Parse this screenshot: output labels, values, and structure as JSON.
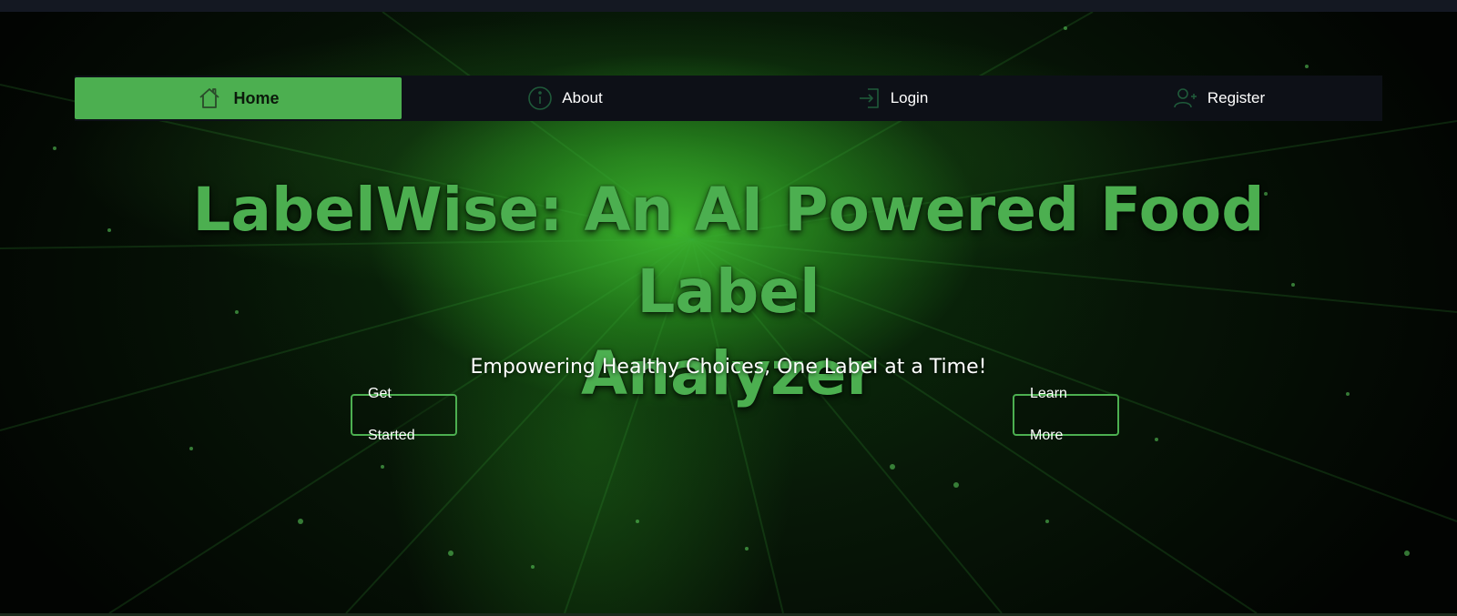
{
  "nav": {
    "items": [
      {
        "label": "Home",
        "icon": "home-icon",
        "active": true
      },
      {
        "label": "About",
        "icon": "info-icon",
        "active": false
      },
      {
        "label": "Login",
        "icon": "login-icon",
        "active": false
      },
      {
        "label": "Register",
        "icon": "add-user-icon",
        "active": false
      }
    ]
  },
  "hero": {
    "title_line1": "LabelWise: An AI Powered Food Label",
    "title_line2": "Analyzer",
    "tagline": "Empowering Healthy Choices, One Label at a Time!",
    "primary_button": "Get Started",
    "secondary_button": "Learn More"
  },
  "colors": {
    "accent": "#4caf50",
    "nav_background": "#0d1017",
    "background": "#020402"
  }
}
